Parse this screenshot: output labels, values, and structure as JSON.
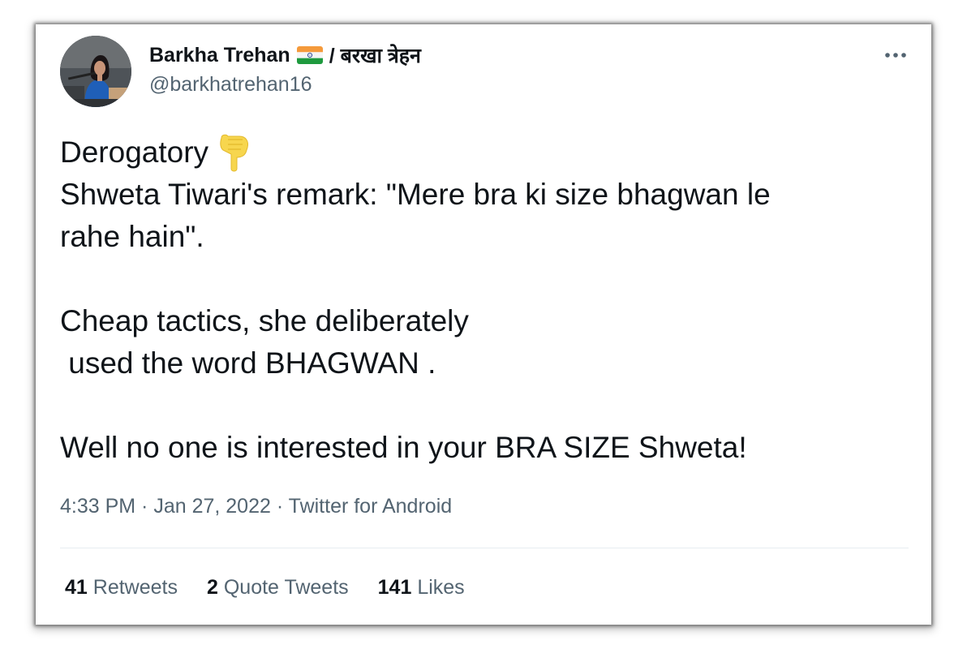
{
  "author": {
    "display_name": "Barkha Trehan",
    "flag_icon": "india-flag-icon",
    "display_name_alt": "/ बरखा त्रेहन",
    "handle": "@barkhatrehan16"
  },
  "menu_icon": "more-horizontal-icon",
  "tweet": {
    "lines": [
      "Derogatory",
      "Shweta Tiwari's remark: \"Mere bra ki size bhagwan le",
      "rahe hain\".",
      "",
      "Cheap tactics, she deliberately",
      " used the word BHAGWAN .",
      "",
      "Well no one is interested in your BRA SIZE Shweta!"
    ],
    "emoji_icon": "backhand-index-pointing-down-icon"
  },
  "meta": {
    "time": "4:33 PM",
    "separator": " · ",
    "date": "Jan 27, 2022",
    "source": "Twitter for Android"
  },
  "stats": [
    {
      "count": "41",
      "label": "Retweets"
    },
    {
      "count": "2",
      "label": "Quote Tweets"
    },
    {
      "count": "141",
      "label": "Likes"
    }
  ],
  "colors": {
    "text_primary": "#0f1419",
    "text_secondary": "#536471",
    "divider": "#e6ecf0",
    "emoji": "#f7d64e"
  }
}
